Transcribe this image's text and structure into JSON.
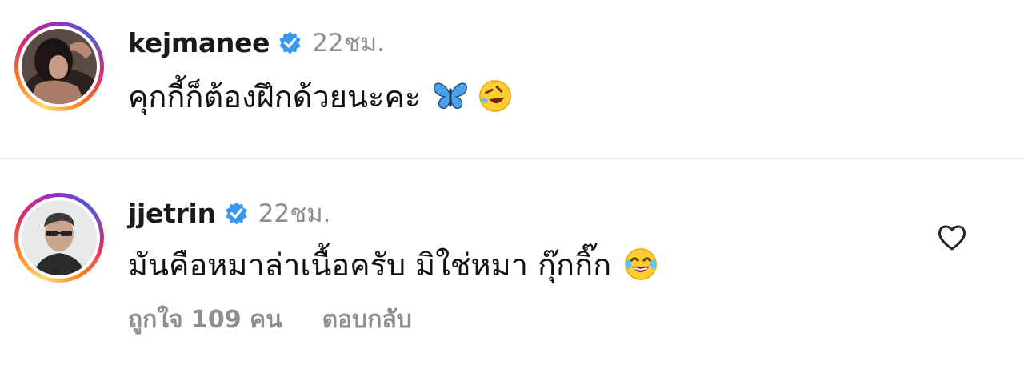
{
  "comments": [
    {
      "username": "kejmanee",
      "verified": true,
      "time": "22ชม.",
      "text": "คุกกี้ก็ต้องฝึกด้วยนะคะ",
      "emojis": [
        "butterfly-emoji",
        "rolling-on-floor-laughing-emoji"
      ]
    },
    {
      "username": "jjetrin",
      "verified": true,
      "time": "22ชม.",
      "text": "มันคือหมาล่าเนื้อครับ มิใช่หมา กุ๊กกิ๊ก",
      "emojis": [
        "face-with-tears-of-joy-emoji"
      ],
      "likes_label": "ถูกใจ 109 คน",
      "reply_label": "ตอบกลับ"
    }
  ],
  "colors": {
    "verified_blue": "#3897f0",
    "secondary_text": "#8e8e8e",
    "divider": "#ececec"
  }
}
